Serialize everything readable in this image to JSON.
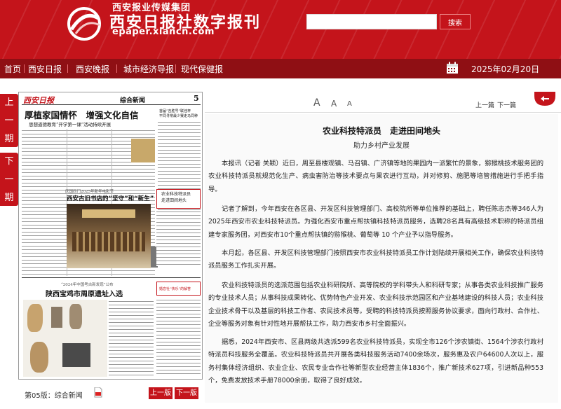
{
  "header": {
    "group_name": "西安报业传媒集团",
    "site_title": "西安日报社数字报刊",
    "site_url": "epaper.xiancn.com",
    "search_placeholder": "",
    "search_label": "搜索"
  },
  "nav": {
    "items": [
      "首页",
      "西安日报",
      "西安晚报",
      "城市经济导报",
      "现代保健报"
    ],
    "date": "2025年02月20日"
  },
  "side": {
    "prev_issue": [
      "上",
      "一",
      "期"
    ],
    "next_issue": [
      "下",
      "一",
      "期"
    ]
  },
  "newspaper": {
    "masthead": "西安日报",
    "section": "综合新闻",
    "page_no": "5",
    "headline_main": "厚植家国情怀　增强文化自信",
    "headline_sub": "思想道德教育“开学第一课”活动持续开展",
    "right_headline": "首届“吉胜号”联佳杯\n不同寻常最少赛走马同种",
    "mid_kicker": "庆国同门2025年新年电影节",
    "mid_headline": "西安古旧书店的“坚守”和“新生”",
    "box_text": "农业科技特派员\n走进田间地头",
    "lower_kicker": "“2024年中国考古新发现”公布",
    "lower_headline": "陕西宝鸡市周原遗址入选",
    "ad_text": "婚恋社“快乐”的解答"
  },
  "bottom": {
    "page_label": "第05版：综合新闻",
    "prev_page": "上一版",
    "next_page": "下一版"
  },
  "toolbar": {
    "font_large": "A",
    "font_medium": "A",
    "font_small": "A",
    "prev_article": "上一篇",
    "next_article": "下一篇"
  },
  "article": {
    "title": "农业科技特派员　走进田间地头",
    "subtitle": "助力乡村产业发展",
    "paragraphs": [
      "本报讯（记者 关颖）近日，周至县楼观镇、马召镇、广济镇等地的果园内一派繁忙的景象，猕猴桃技术服务团的农业科技特派员就规范化生产、病虫害防治等技术要点与果农进行互动，并对修剪、施肥等培管措施进行手把手指导。",
      "记者了解到，今年西安在各区县、开发区科技管理部门、高校院所等单位推荐的基础上，聘任陈志杰等346人为2025年西安市农业科技特派员。为强化西安市重点帮扶镇科技特派员服务，选聘28名具有高级技术职称的特派员组建专家服务团，对西安市10个重点帮扶镇的猕猴桃、葡萄等 10 个产业予以指导服务。",
      "本月起，各区县、开发区科技管理部门按照西安市农业科技特派员工作计划陆续开展相关工作，确保农业科技特派员服务工作扎实开展。",
      "农业科技特派员的选派范围包括农业科研院所、高等院校的学科带头人和科研专家；从事各类农业科技推广服务的专业技术人员；从事科技成果转化、优势特色产业开发、农业科技示范园区和产业基地建设的科技人员；农业科技企业技术骨干以及基层的科技工作者、农民技术员等。受聘的科技特派员按照服务协议要求，面向行政村、合作社、企业等服务对象有针对性地开展帮扶工作，助力西安市乡村全面振兴。",
      "据悉，2024年西安市、区县两级共选派599名农业科技特派员，实现全市126个涉农镇街、1564个涉农行政村特派员科技服务全覆盖。农业科技特派员共开展各类科技服务活动7400余场次，服务惠及农户64600人次以上，服务村集体经济组织、农业企业、农民专业合作社等新型农业经营主体1836个，推广新技术627项，引进新品种553个，免费发放技术手册78000余册，取得了良好成效。"
    ]
  },
  "colors": {
    "brand_red": "#c4141b",
    "nav_dark_red": "#8f0f14"
  },
  "icons": [
    "calendar-icon",
    "pdf-icon",
    "back-arrow-icon",
    "logo-emblem"
  ]
}
